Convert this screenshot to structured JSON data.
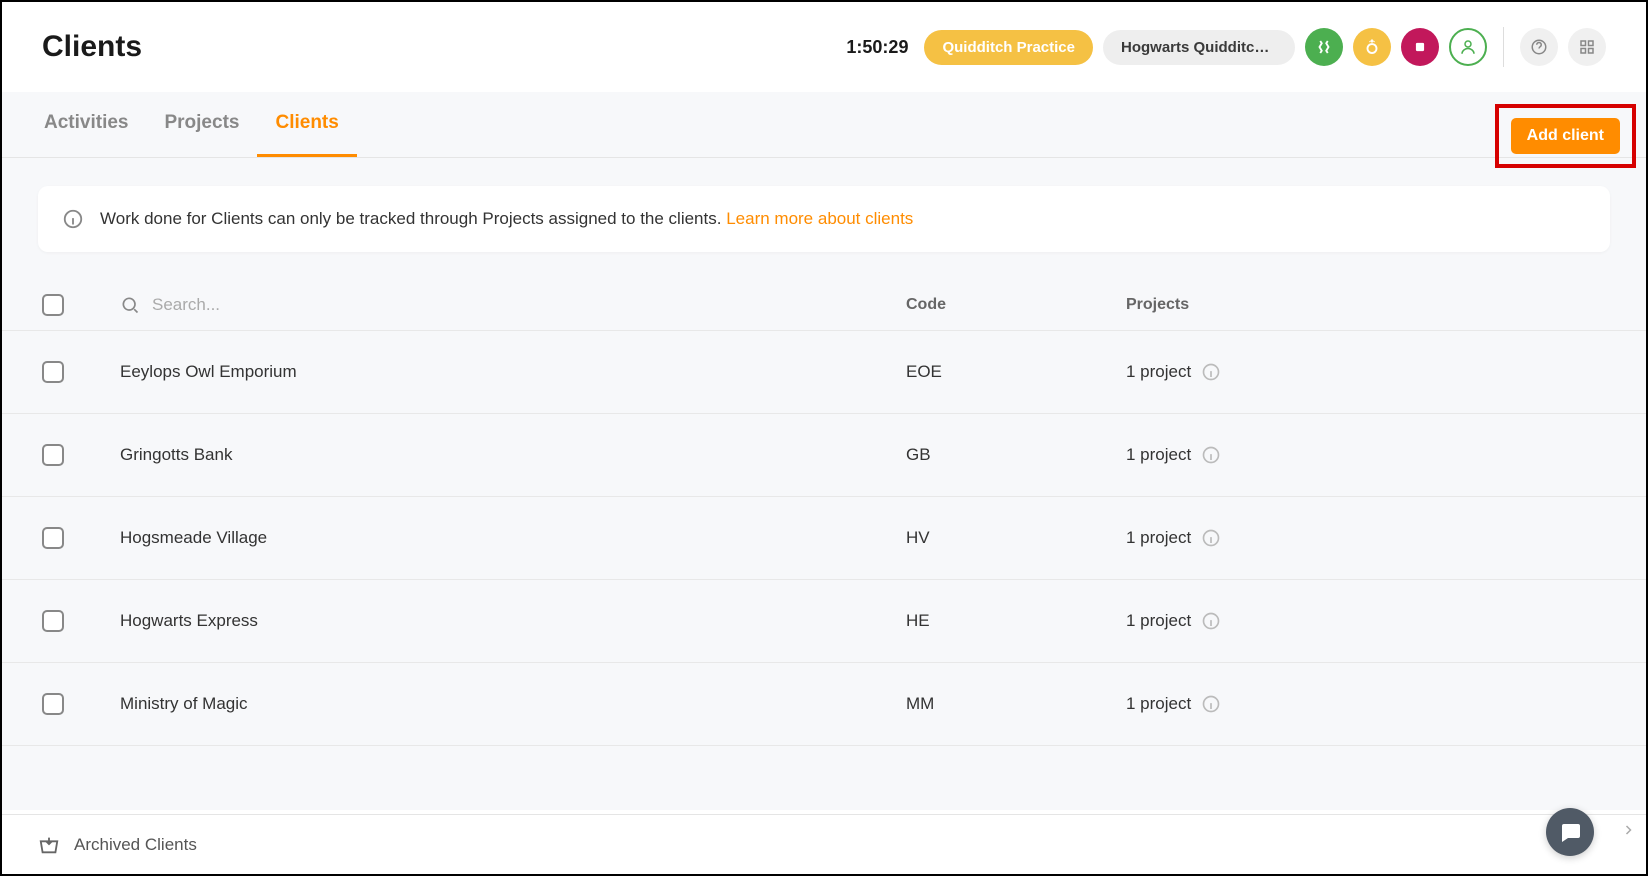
{
  "header": {
    "title": "Clients",
    "timer": "1:50:29",
    "badge1": "Quidditch Practice",
    "badge2": "Hogwarts Quidditch To..."
  },
  "tabs": {
    "activities": "Activities",
    "projects": "Projects",
    "clients": "Clients"
  },
  "addButton": "Add client",
  "banner": {
    "text": "Work done for Clients can only be tracked through Projects assigned to the clients.",
    "link": "Learn more about clients"
  },
  "search": {
    "placeholder": "Search..."
  },
  "columns": {
    "code": "Code",
    "projects": "Projects"
  },
  "clients": [
    {
      "name": "Eeylops Owl Emporium",
      "code": "EOE",
      "projects": "1 project"
    },
    {
      "name": "Gringotts Bank",
      "code": "GB",
      "projects": "1 project"
    },
    {
      "name": "Hogsmeade Village",
      "code": "HV",
      "projects": "1 project"
    },
    {
      "name": "Hogwarts Express",
      "code": "HE",
      "projects": "1 project"
    },
    {
      "name": "Ministry of Magic",
      "code": "MM",
      "projects": "1 project"
    }
  ],
  "footer": {
    "archived": "Archived Clients"
  }
}
